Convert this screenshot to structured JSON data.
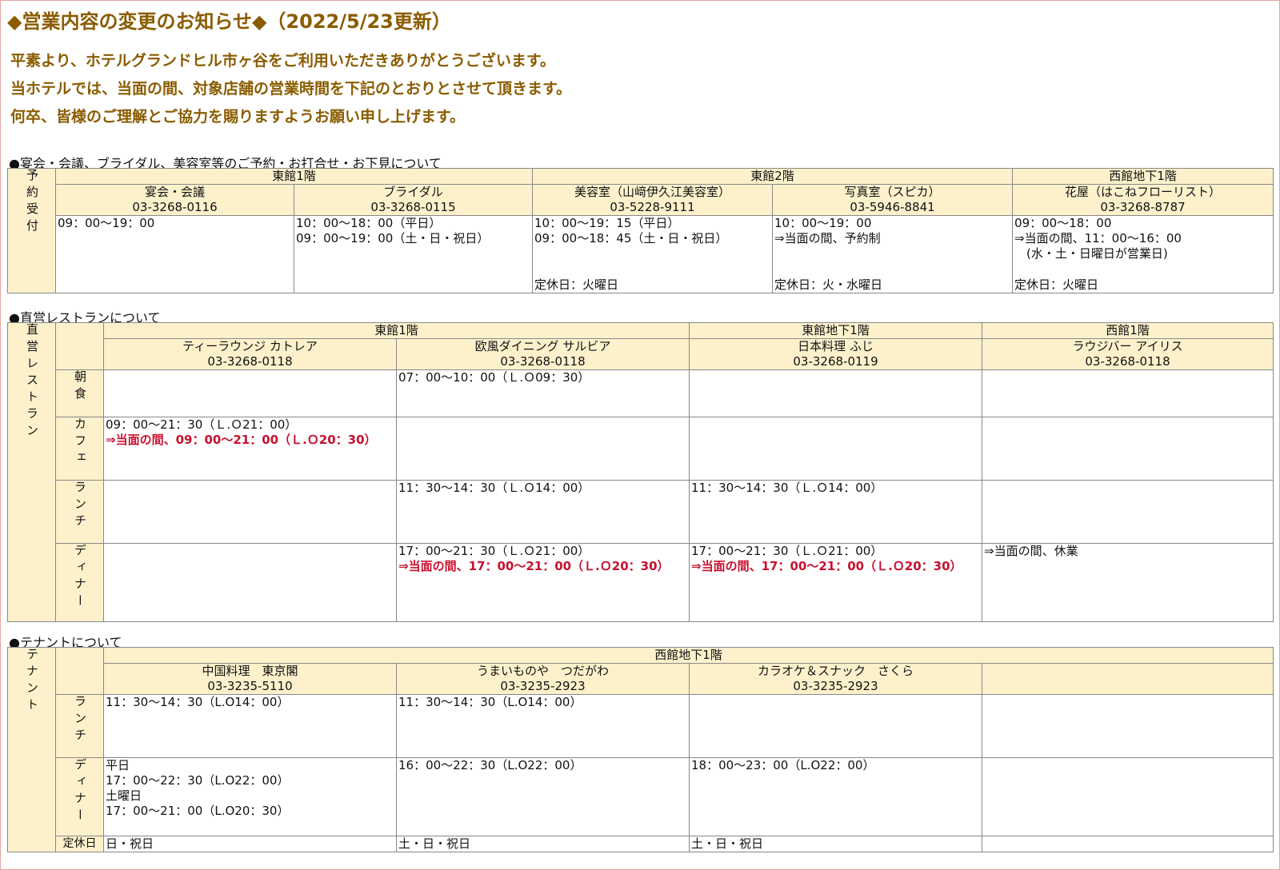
{
  "title": "◆営業内容の変更のお知らせ◆（2022/5/23更新）",
  "intro": [
    "平素より、ホテルグランドヒル市ヶ谷をご利用いただきありがとうございます。",
    "当ホテルでは、当面の間、対象店舗の営業時間を下記のとおりとさせて頂きます。",
    "何卒、皆様のご理解とご協力を賜りますようお願い申し上げます。"
  ],
  "section1": {
    "heading": "●宴会・会議、ブライダル、美容室等のご予約・お打合せ・お下見について",
    "side_label": "予約受付",
    "floors": [
      "東館1階",
      "東館2階",
      "西館地下1階"
    ],
    "shops": [
      {
        "name": "宴会・会議",
        "tel": "03-3268-0116",
        "hours": "09：00〜19：00"
      },
      {
        "name": "ブライダル",
        "tel": "03-3268-0115",
        "hours": "10：00〜18：00（平日）\n09：00〜19：00（土・日・祝日）"
      },
      {
        "name": "美容室（山﨑伊久江美容室）",
        "tel": "03-5228-9111",
        "hours": "10：00〜19：15（平日）\n09：00〜18：45（土・日・祝日）",
        "closed": "定休日：火曜日"
      },
      {
        "name": "写真室（スピカ）",
        "tel": "03-5946-8841",
        "hours": "10：00〜19：00\n⇒当面の間、予約制",
        "closed": "定休日：火・水曜日"
      },
      {
        "name": "花屋（はこねフローリスト）",
        "tel": "03-3268-8787",
        "hours": "09：00〜18：00\n⇒当面の間、11：00〜16：00\n　(水・土・日曜日が営業日)",
        "closed": "定休日：火曜日"
      }
    ]
  },
  "section2": {
    "heading": "●直営レストランについて",
    "side_label": "直営レストラン",
    "floors": [
      "東館1階",
      "東館地下1階",
      "西館1階"
    ],
    "shops": [
      {
        "name": "ティーラウンジ カトレア",
        "tel": "03-3268-0118"
      },
      {
        "name": "欧風ダイニング サルビア",
        "tel": "03-3268-0118"
      },
      {
        "name": "日本料理 ふじ",
        "tel": "03-3268-0119"
      },
      {
        "name": "ラウジバー アイリス",
        "tel": "03-3268-0118"
      }
    ],
    "rows": [
      {
        "label": "朝食",
        "cells": [
          {
            "text": ""
          },
          {
            "text": "07：00〜10：00（Ｌ.Ｏ09：30）"
          },
          {
            "text": ""
          },
          {
            "text": ""
          }
        ]
      },
      {
        "label": "カフェ",
        "cells": [
          {
            "text": "09：00〜21：30（Ｌ.Ｏ21：00）",
            "red": "⇒当面の間、09：00〜21：00（Ｌ.Ｏ20：30）"
          },
          {
            "text": ""
          },
          {
            "text": ""
          },
          {
            "text": ""
          }
        ]
      },
      {
        "label": "ランチ",
        "cells": [
          {
            "text": ""
          },
          {
            "text": "11：30〜14：30（Ｌ.Ｏ14：00）"
          },
          {
            "text": "11：30〜14：30（Ｌ.Ｏ14：00）"
          },
          {
            "text": ""
          }
        ]
      },
      {
        "label": "ディナー",
        "cells": [
          {
            "text": ""
          },
          {
            "text": "17：00〜21：30（Ｌ.Ｏ21：00）",
            "red": "⇒当面の間、17：00〜21：00（Ｌ.Ｏ20：30）"
          },
          {
            "text": "17：00〜21：30（Ｌ.Ｏ21：00）",
            "red": "⇒当面の間、17：00〜21：00（Ｌ.Ｏ20：30）"
          },
          {
            "text": "⇒当面の間、休業"
          }
        ]
      }
    ]
  },
  "section3": {
    "heading": "●テナントについて",
    "side_label": "テナント",
    "floor": "西館地下1階",
    "shops": [
      {
        "name": "中国料理　東京閣",
        "tel": "03-3235-5110"
      },
      {
        "name": "うまいものや　つだがわ",
        "tel": "03-3235-2923"
      },
      {
        "name": "カラオケ＆スナック　さくら",
        "tel": "03-3235-2923"
      },
      {
        "name": "",
        "tel": ""
      }
    ],
    "rows": [
      {
        "label": "ランチ",
        "cells": [
          "11：30〜14：30（L.O14：00）",
          "11：30〜14：30（L.O14：00）",
          "",
          ""
        ]
      },
      {
        "label": "ディナー",
        "cells": [
          "平日\n17：00〜22：30（L.O22：00）\n土曜日\n17：00〜21：00（L.O20：30）",
          "16：00〜22：30（L.O22：00）",
          "18：00〜23：00（L.O22：00）",
          ""
        ]
      },
      {
        "label": "定休日",
        "cells": [
          "日・祝日",
          "土・日・祝日",
          "土・日・祝日",
          ""
        ]
      }
    ]
  }
}
